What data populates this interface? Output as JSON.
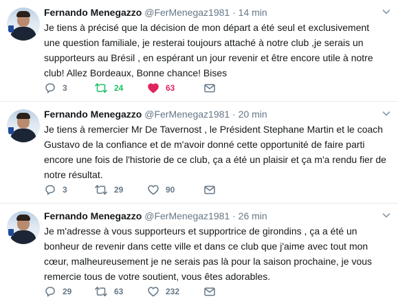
{
  "timeline": {
    "tweets": [
      {
        "name": "Fernando Menegazzo",
        "handle": "@FerMenegaz1981",
        "separator": "·",
        "time": "14 min",
        "text": "Je tiens à précisé que la décision de mon départ a été seul et exclusivement une question familiale, je resterai toujours attaché à notre club ,je serais un supporteurs au Brésil , en espérant un jour revenir et être encore utile à notre club! Allez Bordeaux, Bonne chance! Bises",
        "replies": "3",
        "retweets": "24",
        "likes": "63",
        "retweeted": true,
        "liked": true
      },
      {
        "name": "Fernando Menegazzo",
        "handle": "@FerMenegaz1981",
        "separator": "·",
        "time": "20 min",
        "text": "Je tiens à remercier Mr De Tavernost , le Président Stephane Martin et le coach Gustavo de la confiance et de m'avoir donné cette opportunité de faire parti encore une fois de l'historie de ce club, ça a été un plaisir et ça m'a rendu fier de notre résultat.",
        "replies": "3",
        "retweets": "29",
        "likes": "90",
        "retweeted": false,
        "liked": false
      },
      {
        "name": "Fernando Menegazzo",
        "handle": "@FerMenegaz1981",
        "separator": "·",
        "time": "26 min",
        "text": "Je m'adresse à vous supporteurs et supportrice de girondins , ça a été un bonheur de revenir dans cette ville et dans ce club que j'aime avec tout mon cœur, malheureusement je ne serais pas là pour la saison prochaine, je vous remercie tous de votre soutient, vous êtes adorables.",
        "replies": "29",
        "retweets": "63",
        "likes": "232",
        "retweeted": false,
        "liked": false
      }
    ]
  },
  "icons": {
    "reply": "reply-icon",
    "retweet": "retweet-icon",
    "like": "heart-icon",
    "dm": "envelope-icon",
    "menu": "chevron-down-icon"
  },
  "colors": {
    "muted": "#657786",
    "retweet_active": "#17bf63",
    "like_active": "#e0245e",
    "text": "#14171a",
    "divider": "#e6ecf0"
  }
}
